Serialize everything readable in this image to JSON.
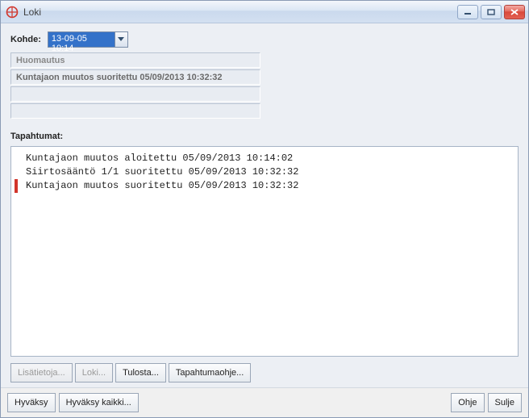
{
  "window": {
    "title": "Loki"
  },
  "form": {
    "kohde_label": "Kohde:",
    "kohde_value": "13-09-05 10:14",
    "notice_title": "Huomautus",
    "notice_msg": "Kuntajaon muutos suoritettu 05/09/2013 10:32:32",
    "events_label": "Tapahtumat:"
  },
  "events": [
    {
      "text": "Kuntajaon muutos aloitettu 05/09/2013 10:14:02",
      "selected": false
    },
    {
      "text": "Siirtosääntö 1/1 suoritettu 05/09/2013 10:32:32",
      "selected": false
    },
    {
      "text": "Kuntajaon muutos suoritettu 05/09/2013 10:32:32",
      "selected": true
    }
  ],
  "toolbar": {
    "lisatietoja": "Lisätietoja...",
    "loki": "Loki...",
    "tulosta": "Tulosta...",
    "tapahtumaohje": "Tapahtumaohje..."
  },
  "footer": {
    "hyvaksy": "Hyväksy",
    "hyvaksy_kaikki": "Hyväksy kaikki...",
    "ohje": "Ohje",
    "sulje": "Sulje"
  }
}
